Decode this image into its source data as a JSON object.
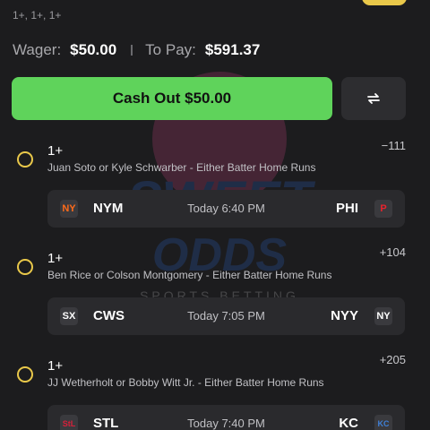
{
  "header": {
    "subtitle": "1+, 1+, 1+"
  },
  "summary": {
    "wager_label": "Wager:",
    "wager_value": "$50.00",
    "topay_label": "To Pay:",
    "topay_value": "$591.37"
  },
  "actions": {
    "cashout_label": "Cash Out $50.00"
  },
  "watermark": {
    "line1": "SWEET",
    "line2": "ODDS",
    "line3": "SPORTS BETTING"
  },
  "legs": [
    {
      "type": "1+",
      "odds": "−111",
      "desc": "Juan Soto or Kyle Schwarber - Either Batter Home Runs",
      "away": {
        "abbr": "NYM",
        "logo": "NY",
        "color": "#ff6b1a"
      },
      "time": "Today 6:40 PM",
      "home": {
        "abbr": "PHI",
        "logo": "P",
        "color": "#e8232d"
      }
    },
    {
      "type": "1+",
      "odds": "+104",
      "desc": "Ben Rice or Colson Montgomery - Either Batter Home Runs",
      "away": {
        "abbr": "CWS",
        "logo": "SX",
        "color": "#ffffff"
      },
      "time": "Today 7:05 PM",
      "home": {
        "abbr": "NYY",
        "logo": "NY",
        "color": "#ffffff"
      }
    },
    {
      "type": "1+",
      "odds": "+205",
      "desc": "JJ Wetherholt or Bobby Witt Jr. - Either Batter Home Runs",
      "away": {
        "abbr": "STL",
        "logo": "StL",
        "color": "#d6203a"
      },
      "time": "Today 7:40 PM",
      "home": {
        "abbr": "KC",
        "logo": "KC",
        "color": "#3f7fd6"
      }
    }
  ],
  "colors": {
    "accent": "#5fd35b",
    "radio": "#e9c84a",
    "background": "#1c1c1e",
    "card": "#2a2a2d"
  }
}
